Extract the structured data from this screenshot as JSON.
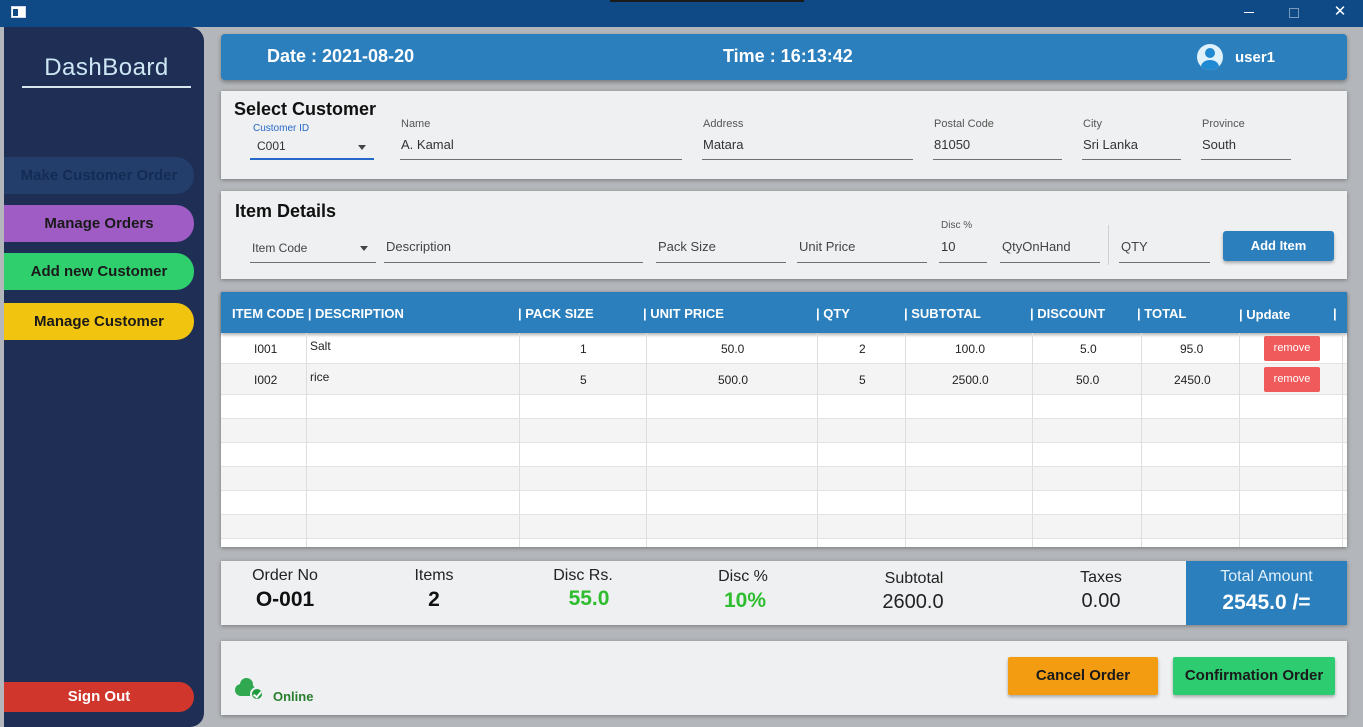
{
  "window": {
    "close_glyph": "✕"
  },
  "sidebar": {
    "title": "DashBoard",
    "items": [
      {
        "label": "Make Customer Order"
      },
      {
        "label": "Manage Orders"
      },
      {
        "label": "Add new Customer"
      },
      {
        "label": "Manage Customer"
      }
    ],
    "signout_label": "Sign Out"
  },
  "header": {
    "date": "Date : 2021-08-20",
    "time": "Time : 16:13:42",
    "user": "user1"
  },
  "customer": {
    "title": "Select Customer",
    "customer_id": {
      "label": "Customer ID",
      "value": "C001"
    },
    "name": {
      "label": "Name",
      "value": "A. Kamal"
    },
    "address": {
      "label": "Address",
      "value": "Matara"
    },
    "postal_code": {
      "label": "Postal Code",
      "value": "81050"
    },
    "city": {
      "label": "City",
      "value": "Sri Lanka"
    },
    "province": {
      "label": "Province",
      "value": "South"
    }
  },
  "item": {
    "title": "Item Details",
    "item_code_prompt": "Item Code",
    "description_prompt": "Description",
    "pack_size_prompt": "Pack Size",
    "unit_price_prompt": "Unit Price",
    "disc": {
      "label": "Disc %",
      "value": "10"
    },
    "qty_on_hand_prompt": "QtyOnHand",
    "qty_prompt": "QTY",
    "add_label": "Add Item"
  },
  "table": {
    "headers": [
      "ITEM CODE |",
      "DESCRIPTION",
      "| PACK SIZE",
      "|  UNIT PRICE",
      "| QTY",
      "| SUBTOTAL",
      "|   DISCOUNT",
      "| TOTAL",
      "| Update",
      "|"
    ],
    "rows": [
      {
        "code": "I001",
        "description": "Salt",
        "pack_size": "1",
        "unit_price": "50.0",
        "qty": "2",
        "subtotal": "100.0",
        "discount": "5.0",
        "total": "95.0",
        "action": "remove"
      },
      {
        "code": "I002",
        "description": "rice",
        "pack_size": "5",
        "unit_price": "500.0",
        "qty": "5",
        "subtotal": "2500.0",
        "discount": "50.0",
        "total": "2450.0",
        "action": "remove"
      }
    ]
  },
  "summary": {
    "order_no": {
      "label": "Order No",
      "value": "O-001"
    },
    "items": {
      "label": "Items",
      "value": "2"
    },
    "disc_rs": {
      "label": "Disc Rs.",
      "value": "55.0"
    },
    "disc_pct": {
      "label": "Disc %",
      "value": "10%"
    },
    "subtotal": {
      "label": "Subtotal",
      "value": "2600.0"
    },
    "taxes": {
      "label": "Taxes",
      "value": "0.00"
    },
    "total_amount": {
      "label": "Total Amount",
      "value": "2545.0 /="
    }
  },
  "footer": {
    "status": "Online",
    "cancel_label": "Cancel Order",
    "confirm_label": "Confirmation Order"
  },
  "colors": {
    "accent": "#2b7fbd",
    "sidebar_bg": "#1f2e55",
    "manage_orders": "#9f5cc4",
    "add_customer": "#2fcf6e",
    "manage_customer": "#f1c40f",
    "sign_out": "#d0362c",
    "cancel": "#f39c12",
    "confirm": "#2ecc71",
    "remove": "#f05a5b",
    "discount_text": "#2ebd2e"
  }
}
